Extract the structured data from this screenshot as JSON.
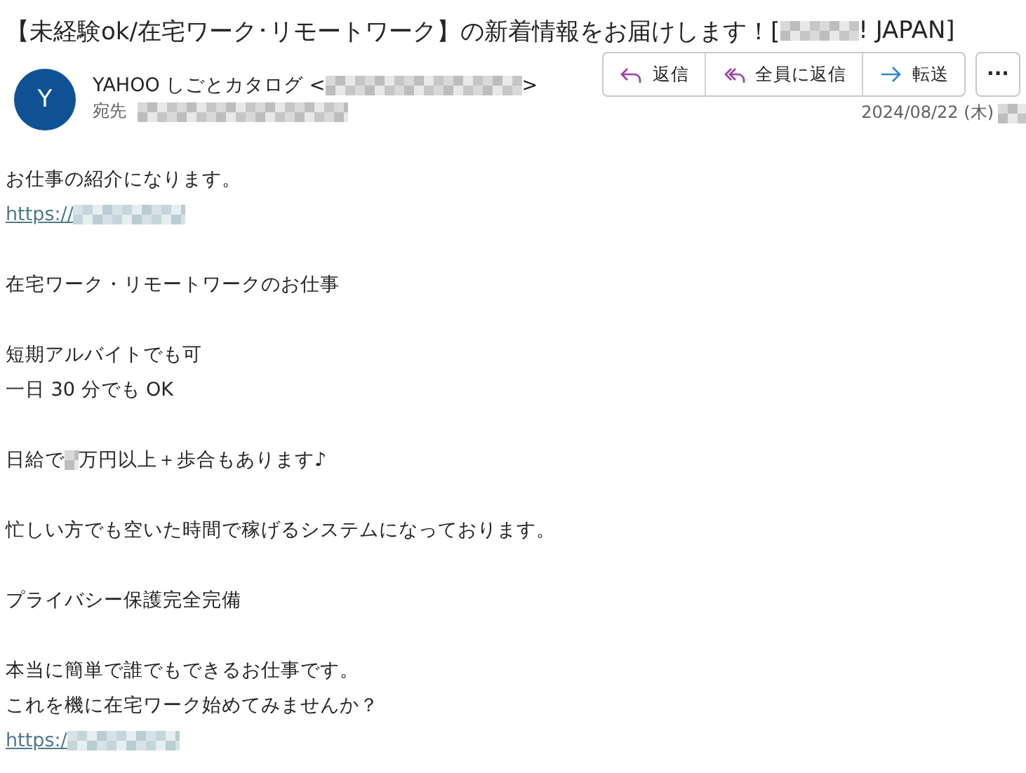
{
  "subject": [
    {
      "kind": "text",
      "text": "【未経験ok/在宅ワーク･リモートワーク】の新着情報をお届けします！["
    },
    {
      "kind": "redacted"
    },
    {
      "kind": "text",
      "text": "! JAPAN]"
    }
  ],
  "sender": {
    "initial": "Y",
    "name": [
      {
        "kind": "text",
        "text": "YAHOO しごとカタログ <"
      },
      {
        "kind": "redacted"
      },
      {
        "kind": "text",
        "text": ">"
      }
    ],
    "to_label": "宛先",
    "date": "2024/08/22 (木)"
  },
  "actions": [
    {
      "kind": "reply",
      "label": "返信"
    },
    {
      "kind": "reply_all",
      "label": "全員に返信"
    },
    {
      "kind": "forward",
      "label": "転送"
    }
  ],
  "more": "···",
  "body": [
    [
      [
        {
          "kind": "text",
          "text": "お仕事の紹介になります。"
        }
      ],
      [
        {
          "kind": "link",
          "text": "https://"
        },
        {
          "kind": "redacted"
        }
      ]
    ],
    [
      [
        {
          "kind": "text",
          "text": "在宅ワーク・リモートワークのお仕事"
        }
      ]
    ],
    [
      [
        {
          "kind": "text",
          "text": "短期アルバイトでも可"
        }
      ],
      [
        {
          "kind": "text",
          "text": "一日 30 分でも OK"
        }
      ]
    ],
    [
      [
        {
          "kind": "text",
          "text": "日給で"
        },
        {
          "kind": "redacted"
        },
        {
          "kind": "text",
          "text": "万円以上＋歩合もあります♪"
        }
      ]
    ],
    [
      [
        {
          "kind": "text",
          "text": "忙しい方でも空いた時間で稼げるシステムになっております。"
        }
      ]
    ],
    [
      [
        {
          "kind": "text",
          "text": "プライバシー保護完全完備"
        }
      ]
    ],
    [
      [
        {
          "kind": "text",
          "text": "本当に簡単で誰でもできるお仕事です。"
        }
      ],
      [
        {
          "kind": "text",
          "text": "これを機に在宅ワーク始めてみませんか？"
        }
      ],
      [
        {
          "kind": "link",
          "text": "https:/"
        },
        {
          "kind": "redacted"
        }
      ]
    ]
  ]
}
